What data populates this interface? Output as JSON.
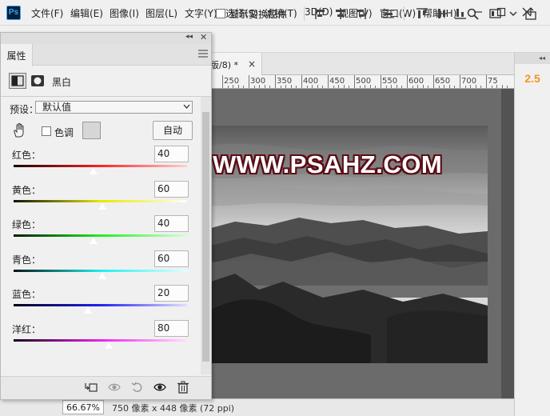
{
  "menu": {
    "app_logo": "Ps",
    "items": [
      "文件(F)",
      "编辑(E)",
      "图像(I)",
      "图层(L)",
      "文字(Y)",
      "选择(S)",
      "滤镜(T)",
      "3D(D)",
      "视图(V)",
      "窗口(W)",
      "帮助(H)"
    ]
  },
  "options_bar": {
    "show_transform_label": "显示变换控件"
  },
  "document": {
    "tab_title": "版/8) *",
    "ruler_ticks": [
      "250",
      "300",
      "350",
      "400",
      "450",
      "500",
      "550",
      "600",
      "650",
      "700",
      "75"
    ],
    "watermark": "WWW.PSAHZ.COM",
    "zoom": "66.67%",
    "info": "750 像素 x 448 像素 (72 ppi)"
  },
  "right_panel": {
    "value": "2.5"
  },
  "properties": {
    "tab_label": "属性",
    "adjustment_name": "黑白",
    "preset_label": "预设：",
    "preset_value": "默认值",
    "tint_label": "色调",
    "auto_button": "自动",
    "sliders": [
      {
        "label": "红色：",
        "value": "40",
        "fraction": 0.46,
        "gradient": [
          "#1a0000",
          "#ff2222",
          "#ffd0d0"
        ]
      },
      {
        "label": "黄色：",
        "value": "60",
        "fraction": 0.51,
        "gradient": [
          "#111100",
          "#e8e800",
          "#fffff0"
        ]
      },
      {
        "label": "绿色：",
        "value": "40",
        "fraction": 0.46,
        "gradient": [
          "#001a00",
          "#22ee22",
          "#d8ffd8"
        ]
      },
      {
        "label": "青色：",
        "value": "60",
        "fraction": 0.51,
        "gradient": [
          "#001616",
          "#22eeee",
          "#e0ffff"
        ]
      },
      {
        "label": "蓝色：",
        "value": "20",
        "fraction": 0.43,
        "gradient": [
          "#00001a",
          "#2222ee",
          "#e0e0ff"
        ]
      },
      {
        "label": "洋红：",
        "value": "80",
        "fraction": 0.55,
        "gradient": [
          "#1a001a",
          "#ee22ee",
          "#ffe0ff"
        ]
      }
    ]
  },
  "colors": {
    "accent_orange": "#f7941d",
    "watermark_outline": "#5a0d14",
    "ps_blue": "#31a8ff"
  }
}
